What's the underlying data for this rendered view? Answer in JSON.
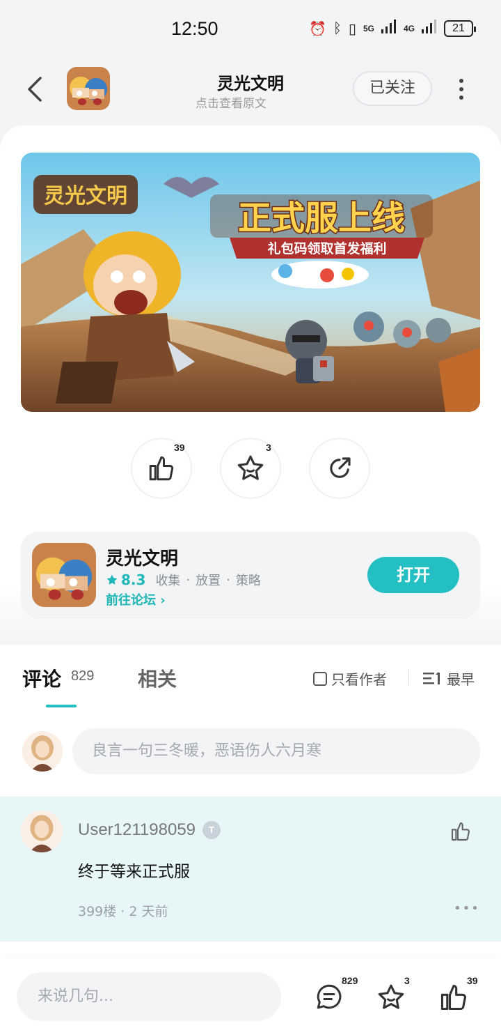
{
  "status": {
    "time": "12:50",
    "battery": "21",
    "network_5g": "5G",
    "network_4g": "4G"
  },
  "nav": {
    "title": "灵光文明",
    "subtitle": "点击查看原文",
    "follow_label": "已关注"
  },
  "banner": {
    "logo_text": "灵光文明",
    "headline": "正式服上线",
    "ribbon_text": "礼包码领取首发福利"
  },
  "actions": {
    "like_count": "39",
    "fav_count": "3"
  },
  "app_card": {
    "name": "灵光文明",
    "rating": "8.3",
    "tags": [
      "收集",
      "放置",
      "策略"
    ],
    "forum_link": "前往论坛",
    "open_label": "打开"
  },
  "comments": {
    "tab_label": "评论",
    "count": "829",
    "related_label": "相关",
    "only_author_label": "只看作者",
    "sort_label": "最早",
    "input_placeholder": "良言一句三冬暖，恶语伤人六月寒",
    "items": [
      {
        "user": "User121198059",
        "text": "终于等来正式服",
        "meta": "399楼 · 2 天前"
      }
    ]
  },
  "bottom": {
    "placeholder": "来说几句...",
    "comment_count": "829",
    "fav_count": "3",
    "like_count": "39"
  },
  "colors": {
    "accent": "#23bfc3",
    "highlight_bg": "#e7f7f8"
  }
}
